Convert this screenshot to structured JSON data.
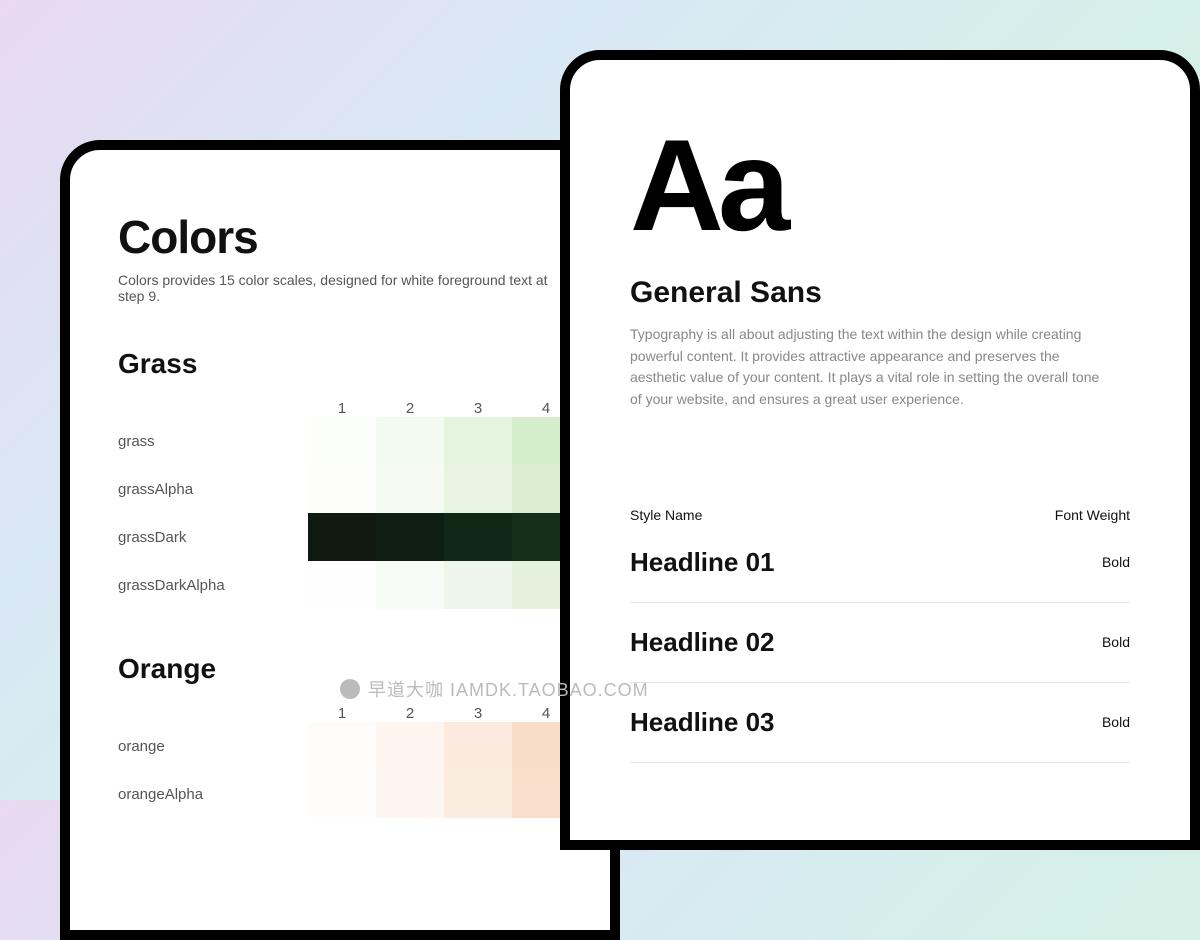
{
  "left": {
    "title": "Colors",
    "subtitle": "Colors provides 15 color scales, designed for white foreground text at step 9.",
    "sections": [
      {
        "name": "Grass",
        "cols": [
          "1",
          "2",
          "3",
          "4"
        ],
        "rows": [
          {
            "name": "grass",
            "swatches": [
              "#fcfefb",
              "#f3fbf1",
              "#e4f4de",
              "#d4edcb"
            ]
          },
          {
            "name": "grassAlpha",
            "swatches": [
              "#fdfefc",
              "#f5fbf2",
              "#e9f5e2",
              "#daeecf"
            ]
          },
          {
            "name": "grassDark",
            "swatches": [
              "#0e1a0f",
              "#0f2012",
              "#122816",
              "#15301a"
            ]
          },
          {
            "name": "grassDarkAlpha",
            "swatches": [
              "#fdfefd",
              "#f7fbf5",
              "#eef6ea",
              "#e4f1dd"
            ]
          }
        ]
      },
      {
        "name": "Orange",
        "cols": [
          "1",
          "2",
          "3",
          "4"
        ],
        "rows": [
          {
            "name": "orange",
            "swatches": [
              "#fefcfa",
              "#fdf5ee",
              "#fbeadd",
              "#f8ddc8"
            ]
          },
          {
            "name": "orangeAlpha",
            "swatches": [
              "#fefdfb",
              "#fdf6f0",
              "#fbece0",
              "#f8decb"
            ]
          }
        ]
      }
    ]
  },
  "right": {
    "specimen": "Aa",
    "fontName": "General Sans",
    "description": "Typography is all about adjusting the text within the design while creating powerful content. It provides attractive appearance and preserves the aesthetic value of your content. It plays a vital role in setting the overall tone of your website, and ensures a great user experience.",
    "tableHead": {
      "left": "Style Name",
      "right": "Font Weight"
    },
    "rows": [
      {
        "name": "Headline 01",
        "weight": "Bold"
      },
      {
        "name": "Headline 02",
        "weight": "Bold"
      },
      {
        "name": "Headline 03",
        "weight": "Bold"
      }
    ]
  },
  "watermark": "早道大咖  IAMDK.TAOBAO.COM"
}
